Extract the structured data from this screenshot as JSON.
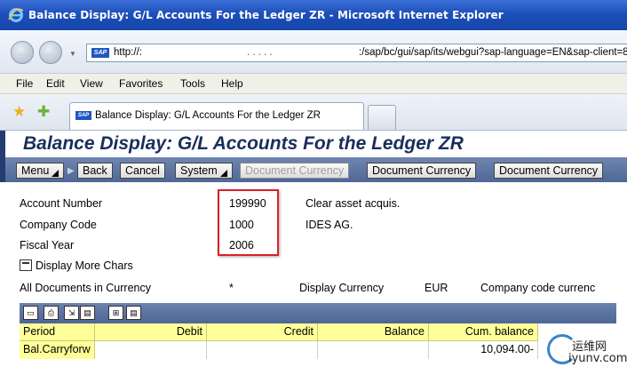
{
  "window": {
    "title": "Balance Display: G/L Accounts For the Ledger ZR - Microsoft Internet Explorer"
  },
  "address": {
    "url_prefix": "http://:",
    "url_obscured": ". . . . .",
    "url_path": ":/sap/bc/gui/sap/its/webgui?sap-language=EN&sap-client=800&~transa"
  },
  "menu": [
    "File",
    "Edit",
    "View",
    "Favorites",
    "Tools",
    "Help"
  ],
  "tab": {
    "title": "Balance Display: G/L Accounts For the Ledger ZR"
  },
  "sap": {
    "title": "Balance Display: G/L Accounts For the Ledger ZR",
    "buttons": {
      "menu": "Menu",
      "back": "Back",
      "cancel": "Cancel",
      "system": "System",
      "doc_currency_1": "Document Currency",
      "doc_currency_2": "Document Currency",
      "doc_currency_3": "Document Currency"
    },
    "fields": {
      "account_label": "Account Number",
      "account_value": "199990",
      "account_desc": "Clear asset acquis.",
      "company_label": "Company Code",
      "company_value": "1000",
      "company_desc": "IDES AG.",
      "year_label": "Fiscal Year",
      "year_value": "2006"
    },
    "more_chars": "Display More Chars",
    "currency_row": {
      "all_docs_label": "All Documents in Currency",
      "all_docs_value": "*",
      "display_currency_label": "Display Currency",
      "display_currency_value": "EUR",
      "company_code_currency": "Company code currenc"
    },
    "table": {
      "columns": [
        "Period",
        "Debit",
        "Credit",
        "Balance",
        "Cum. balance"
      ],
      "rows": [
        {
          "period": "Bal.Carryforw",
          "debit": "",
          "credit": "",
          "balance": "",
          "cum_balance": "10,094.00-"
        }
      ]
    }
  },
  "watermark": {
    "line1": "运维网",
    "line2": "iyunv.com"
  },
  "colors": {
    "title_bar": "#1d4fb8",
    "sap_toolbar": "#5b73a2",
    "header_yellow": "#ffff99",
    "highlight_red": "#d8212c"
  }
}
